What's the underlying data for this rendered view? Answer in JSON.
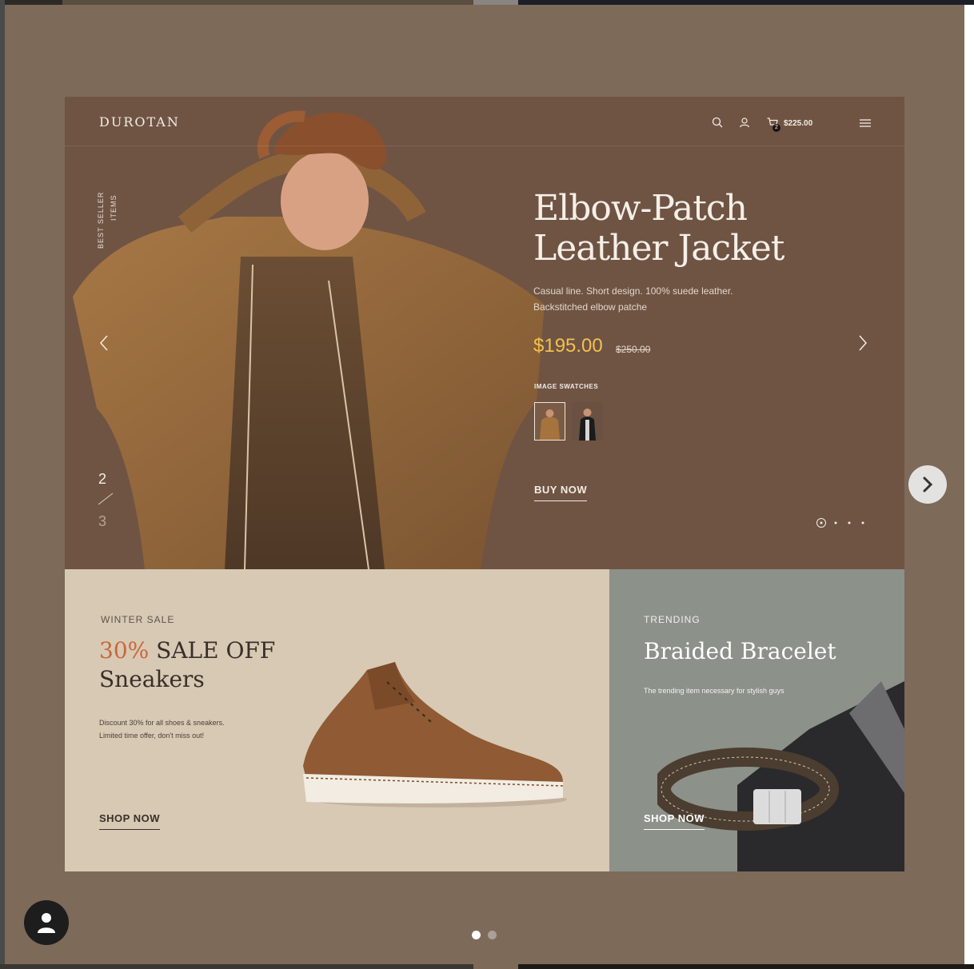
{
  "mockup": {
    "brand": "DUROTAN",
    "nav": {
      "cart_count": "2",
      "cart_total": "$225.00"
    },
    "hero": {
      "side_label_1": "BEST SELLER",
      "side_label_2": "ITEMS",
      "title_line_1": "Elbow-Patch",
      "title_line_2": "Leather Jacket",
      "description": "Casual line. Short design. 100% suede leather. Backstitched elbow patche",
      "price": "$195.00",
      "old_price": "$250.00",
      "swatches_label": "IMAGE SWATCHES",
      "buy_label": "BUY NOW",
      "counter_current": "2",
      "counter_next": "3",
      "slide_dots": 4,
      "active_dot": 1
    },
    "sale_banner": {
      "tag": "WINTER SALE",
      "percent": "30%",
      "headline_rest": " SALE OFF",
      "headline_line2": "Sneakers",
      "description_line1": "Discount 30% for all shoes & sneakers.",
      "description_line2": "Limited time offer, don't miss out!",
      "cta": "SHOP NOW"
    },
    "trend_banner": {
      "tag": "TRENDING",
      "headline": "Braided Bracelet",
      "description": "The trending item necessary for stylish guys",
      "cta": "SHOP NOW"
    }
  },
  "viewer": {
    "pager_count": 2,
    "pager_active": 1
  },
  "colors": {
    "background": "#7d6a59",
    "hero_bg": "#6f5444",
    "price_accent": "#f2c14e",
    "sale_bg": "#d8c9b5",
    "sale_accent": "#c8683a",
    "trend_bg": "#8c918a"
  },
  "icons": [
    "search-icon",
    "user-icon",
    "cart-icon",
    "menu-icon",
    "chevron-left-icon",
    "chevron-right-icon",
    "person-icon"
  ]
}
